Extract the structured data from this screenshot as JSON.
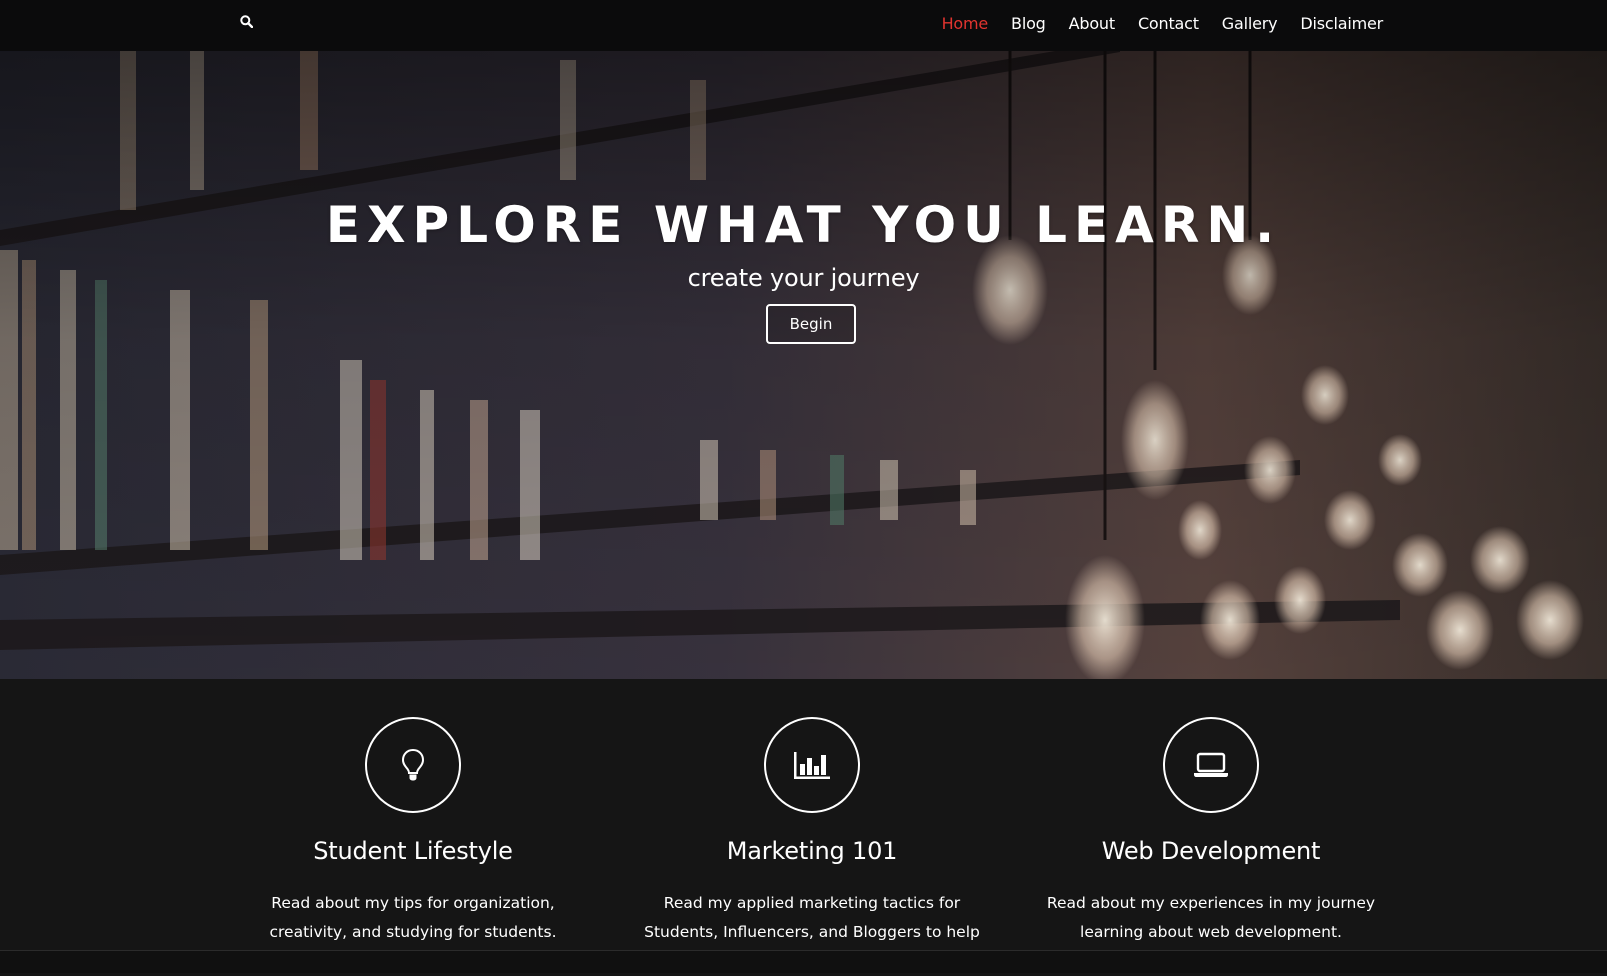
{
  "nav": {
    "search_icon": "search-icon",
    "links": [
      "Home",
      "Blog",
      "About",
      "Contact",
      "Gallery",
      "Disclaimer"
    ],
    "active": "Home",
    "active_color": "#e2342f"
  },
  "hero": {
    "title": "EXPLORE WHAT YOU LEARN.",
    "subtitle": "create your journey",
    "button_label": "Begin"
  },
  "features": [
    {
      "icon": "lightbulb-icon",
      "title": "Student Lifestyle",
      "text": "Read about my tips for organization, creativity, and studying for students."
    },
    {
      "icon": "bar-chart-icon",
      "title": "Marketing 101",
      "text": "Read my applied marketing tactics for Students, Influencers, and Bloggers to help build your"
    },
    {
      "icon": "laptop-icon",
      "title": "Web Development",
      "text": "Read about my experiences in my journey learning about web development."
    }
  ]
}
